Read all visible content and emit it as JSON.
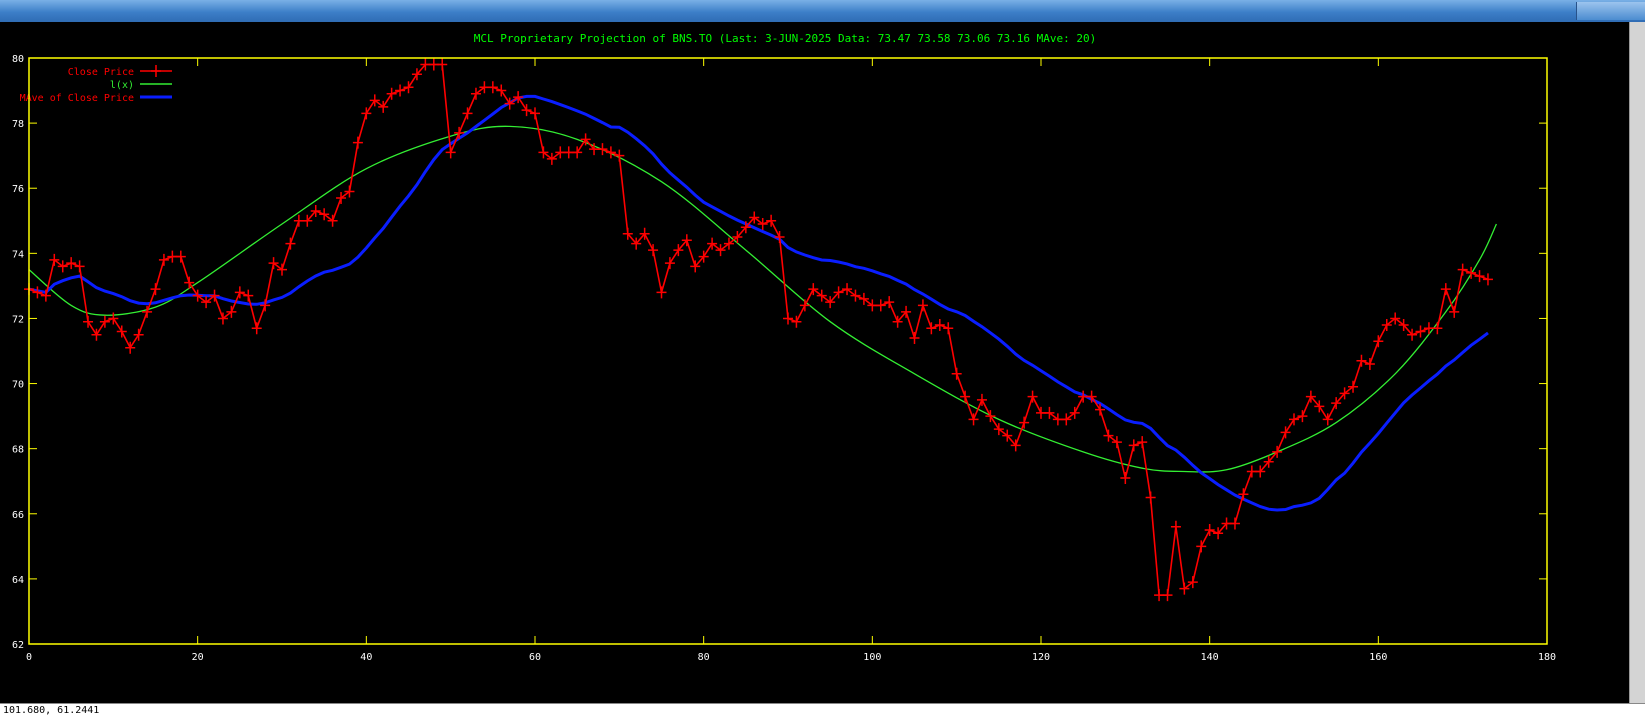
{
  "window": {
    "status_coords": "101.680,  61.2441"
  },
  "colors": {
    "frame": "#ffff00",
    "title": "#00ff00",
    "close": "#ff0000",
    "fit": "#33ee33",
    "mave": "#0a1eff",
    "tick_label": "#ffffff"
  },
  "chart_data": {
    "type": "line",
    "title": "MCL Proprietary Projection of BNS.TO  (Last:  3-JUN-2025    Data: 73.47 73.58 73.06 73.16    MAve: 20)",
    "xlim": [
      0,
      180
    ],
    "ylim": [
      62,
      80
    ],
    "x_ticks": [
      0,
      20,
      40,
      60,
      80,
      100,
      120,
      140,
      160,
      180
    ],
    "y_ticks": [
      62,
      64,
      66,
      68,
      70,
      72,
      74,
      76,
      78,
      80
    ],
    "legend_position": "top-left",
    "series": [
      {
        "name": "Close Price",
        "color": "#ff0000",
        "marker": "+",
        "values": [
          72.9,
          72.8,
          72.7,
          73.8,
          73.6,
          73.7,
          73.6,
          71.9,
          71.5,
          71.9,
          72.0,
          71.6,
          71.1,
          71.5,
          72.2,
          72.9,
          73.8,
          73.9,
          73.9,
          73.1,
          72.7,
          72.5,
          72.7,
          72.0,
          72.2,
          72.8,
          72.7,
          71.7,
          72.4,
          73.7,
          73.5,
          74.3,
          75.0,
          75.0,
          75.3,
          75.2,
          75.0,
          75.7,
          75.9,
          77.4,
          78.3,
          78.7,
          78.5,
          78.9,
          79.0,
          79.1,
          79.5,
          79.8,
          79.8,
          79.8,
          77.1,
          77.7,
          78.3,
          78.9,
          79.1,
          79.1,
          79.0,
          78.6,
          78.8,
          78.4,
          78.3,
          77.1,
          76.9,
          77.1,
          77.1,
          77.1,
          77.5,
          77.2,
          77.2,
          77.1,
          77.0,
          74.6,
          74.3,
          74.6,
          74.1,
          72.8,
          73.7,
          74.1,
          74.4,
          73.6,
          73.9,
          74.3,
          74.1,
          74.3,
          74.5,
          74.8,
          75.1,
          74.9,
          75.0,
          74.5,
          72.0,
          71.9,
          72.4,
          72.9,
          72.7,
          72.5,
          72.8,
          72.9,
          72.7,
          72.6,
          72.4,
          72.4,
          72.5,
          71.9,
          72.2,
          71.4,
          72.4,
          71.7,
          71.8,
          71.7,
          70.3,
          69.6,
          68.9,
          69.5,
          69.0,
          68.6,
          68.4,
          68.1,
          68.8,
          69.6,
          69.1,
          69.1,
          68.9,
          68.9,
          69.1,
          69.6,
          69.6,
          69.2,
          68.4,
          68.2,
          67.1,
          68.1,
          68.2,
          66.5,
          63.5,
          63.5,
          65.6,
          63.7,
          63.9,
          65.0,
          65.5,
          65.4,
          65.7,
          65.7,
          66.6,
          67.3,
          67.3,
          67.6,
          67.9,
          68.5,
          68.9,
          69.0,
          69.6,
          69.3,
          68.9,
          69.4,
          69.7,
          69.9,
          70.7,
          70.6,
          71.3,
          71.8,
          72.0,
          71.8,
          71.5,
          71.6,
          71.7,
          71.7,
          72.9,
          72.2,
          73.5,
          73.4,
          73.3,
          73.2
        ]
      },
      {
        "name": "l(x)",
        "color": "#33ee33",
        "fit": {
          "x": [
            0,
            5,
            9,
            15,
            20,
            30,
            40,
            50,
            57,
            65,
            75,
            85,
            95,
            105,
            115,
            125,
            132,
            137,
            142,
            148,
            155,
            162,
            168,
            172,
            174
          ],
          "y": [
            73.5,
            72.4,
            72.1,
            72.35,
            73.1,
            74.9,
            76.6,
            77.6,
            77.9,
            77.5,
            76.2,
            74.1,
            71.9,
            70.3,
            68.9,
            67.9,
            67.4,
            67.3,
            67.35,
            67.9,
            68.8,
            70.3,
            72.2,
            73.8,
            74.9
          ]
        }
      },
      {
        "name": "MAve of Close Price",
        "color": "#0a1eff",
        "mave_window": 20
      }
    ]
  }
}
